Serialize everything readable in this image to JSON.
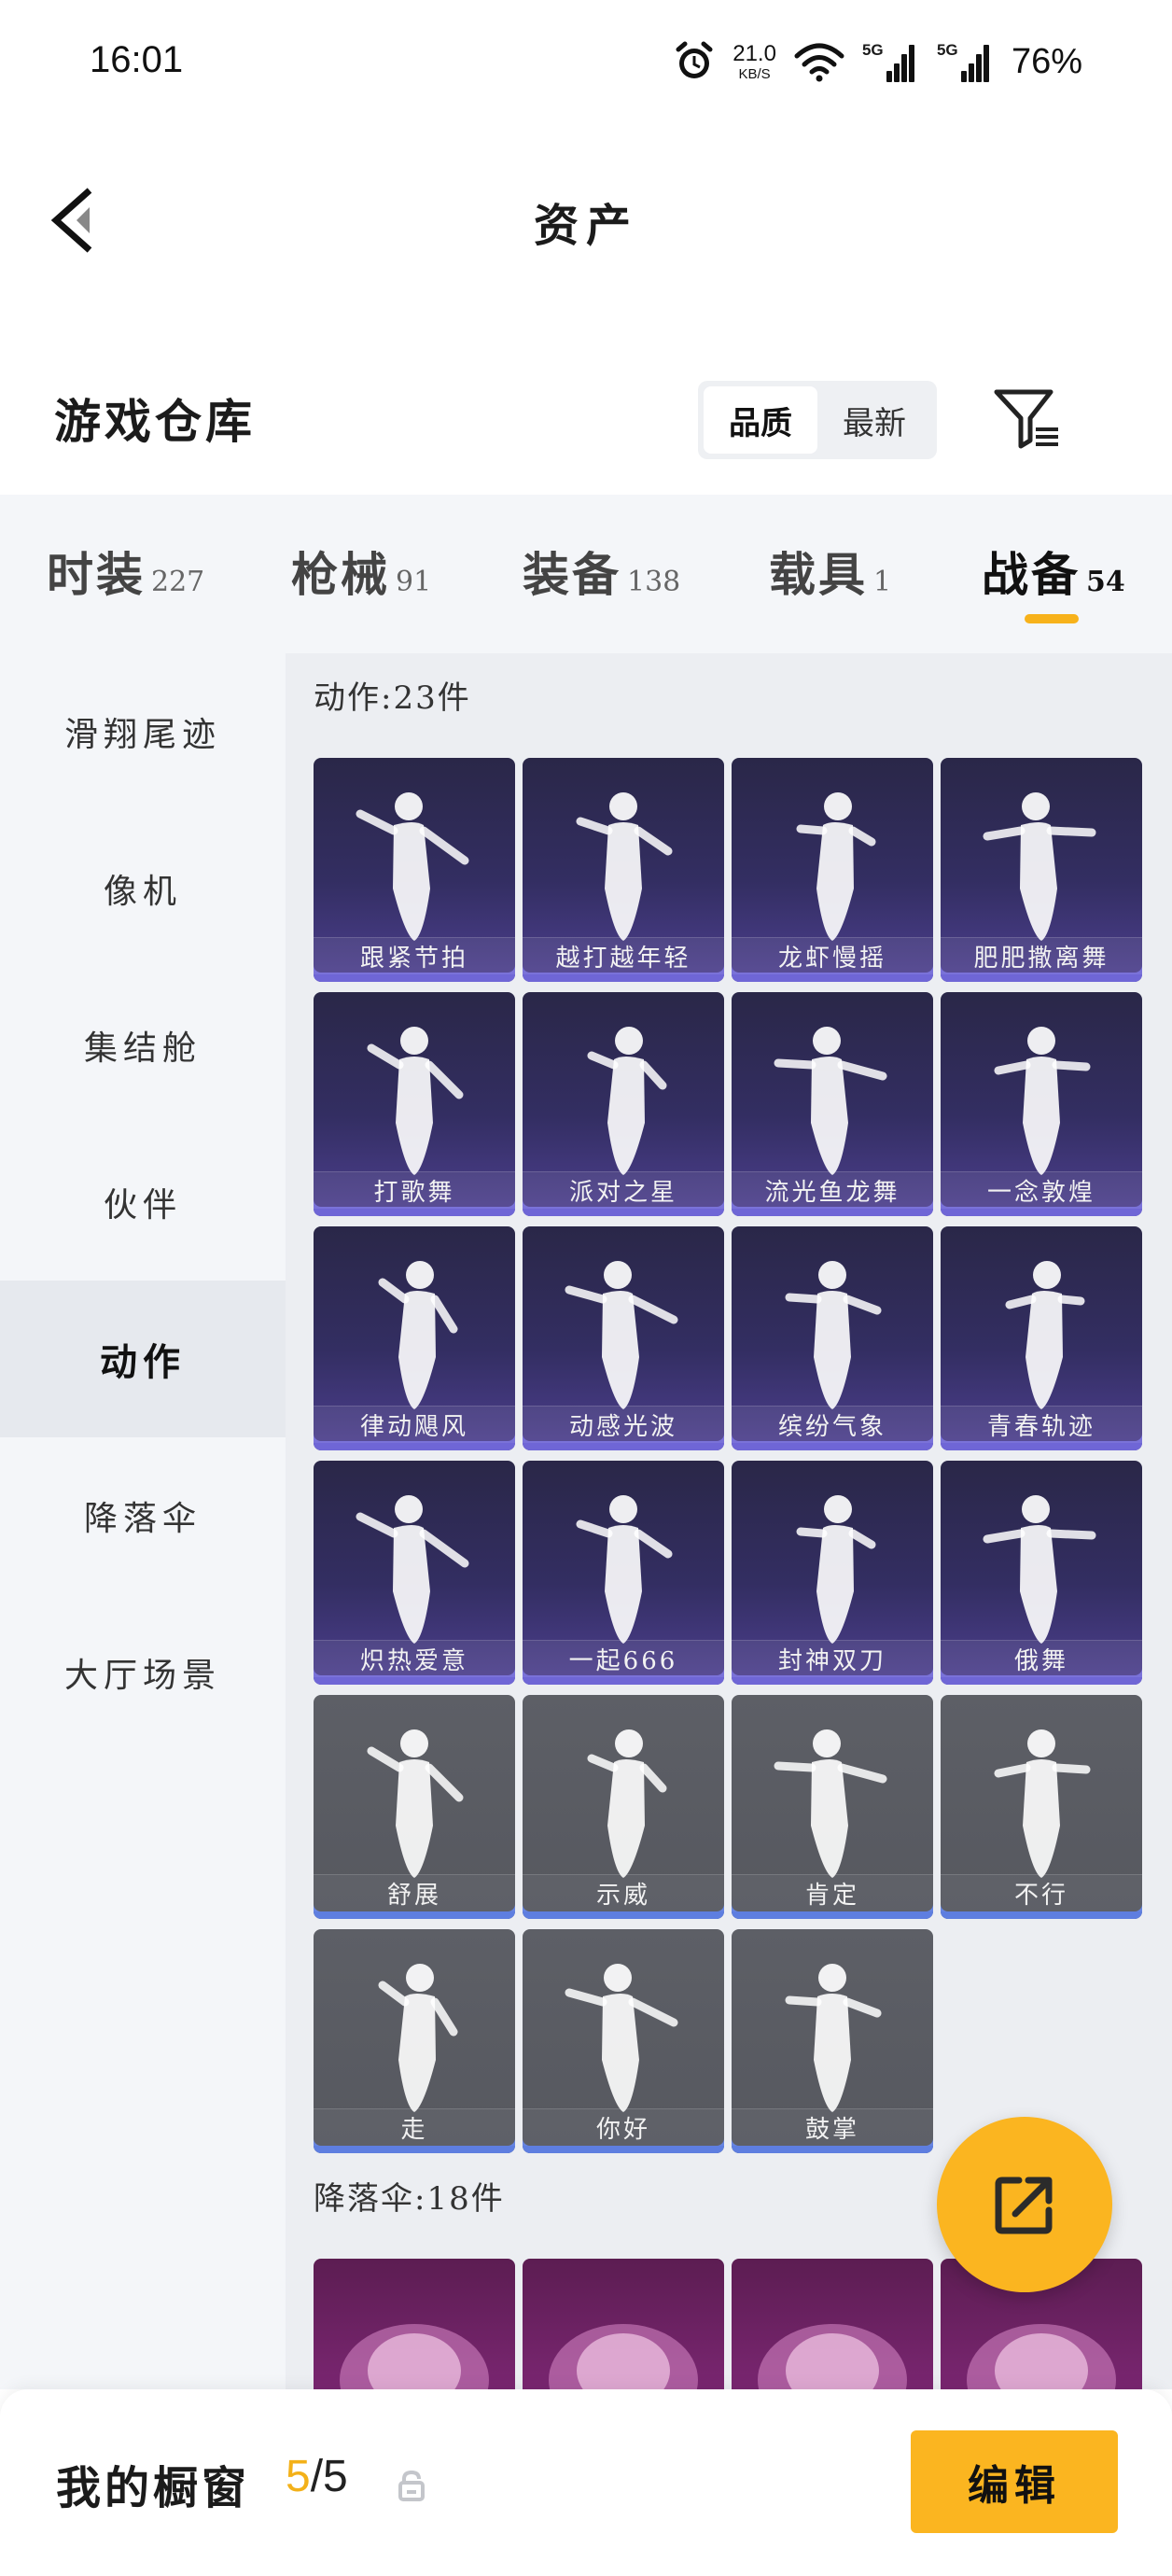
{
  "status_bar": {
    "time": "16:01",
    "speed_value": "21.0",
    "speed_unit": "KB/S",
    "sim1": "5G",
    "sim2": "5G",
    "battery": "76%",
    "icons": [
      "alarm-icon",
      "wifi-icon",
      "signal-icon"
    ]
  },
  "header": {
    "title": "资产"
  },
  "warehouse": {
    "title": "游戏仓库",
    "sort_options": [
      "品质",
      "最新"
    ],
    "active_sort": "品质"
  },
  "category_tabs": [
    {
      "name": "时装",
      "count": "227"
    },
    {
      "name": "枪械",
      "count": "91"
    },
    {
      "name": "装备",
      "count": "138"
    },
    {
      "name": "载具",
      "count": "1"
    },
    {
      "name": "战备",
      "count": "54"
    }
  ],
  "active_tab": "战备",
  "sidebar": {
    "items": [
      {
        "label": "滑翔尾迹"
      },
      {
        "label": "像机"
      },
      {
        "label": "集结舱"
      },
      {
        "label": "伙伴"
      },
      {
        "label": "动作"
      },
      {
        "label": "降落伞"
      },
      {
        "label": "大厅场景"
      }
    ],
    "active": "动作"
  },
  "sections": [
    {
      "title": "动作:23件",
      "items": [
        {
          "label": "跟紧节拍",
          "style": "purple"
        },
        {
          "label": "越打越年轻",
          "style": "purple"
        },
        {
          "label": "龙虾慢摇",
          "style": "purple"
        },
        {
          "label": "肥肥撒离舞",
          "style": "purple"
        },
        {
          "label": "打歌舞",
          "style": "purple"
        },
        {
          "label": "派对之星",
          "style": "purple"
        },
        {
          "label": "流光鱼龙舞",
          "style": "purple"
        },
        {
          "label": "一念敦煌",
          "style": "purple"
        },
        {
          "label": "律动飓风",
          "style": "purple"
        },
        {
          "label": "动感光波",
          "style": "purple"
        },
        {
          "label": "缤纷气象",
          "style": "purple"
        },
        {
          "label": "青春轨迹",
          "style": "purple"
        },
        {
          "label": "炽热爱意",
          "style": "purple"
        },
        {
          "label": "一起666",
          "style": "purple"
        },
        {
          "label": "封神双刀",
          "style": "purple"
        },
        {
          "label": "俄舞",
          "style": "purple"
        },
        {
          "label": "舒展",
          "style": "gray"
        },
        {
          "label": "示威",
          "style": "gray"
        },
        {
          "label": "肯定",
          "style": "gray"
        },
        {
          "label": "不行",
          "style": "gray"
        },
        {
          "label": "走",
          "style": "gray"
        },
        {
          "label": "你好",
          "style": "gray"
        },
        {
          "label": "鼓掌",
          "style": "gray"
        }
      ]
    },
    {
      "title": "降落伞:18件",
      "items": [
        {
          "label": "",
          "style": "pink"
        },
        {
          "label": "",
          "style": "pink"
        },
        {
          "label": "",
          "style": "pink"
        },
        {
          "label": "",
          "style": "pink"
        }
      ]
    }
  ],
  "showcase": {
    "label": "我的橱窗",
    "current": "5",
    "separator": "/",
    "max": "5",
    "edit_label": "编辑"
  },
  "colors": {
    "accent": "#fbb520",
    "tab_underline": "#f7b21b",
    "purple_card": "#332e62",
    "gray_card": "#56585f"
  }
}
